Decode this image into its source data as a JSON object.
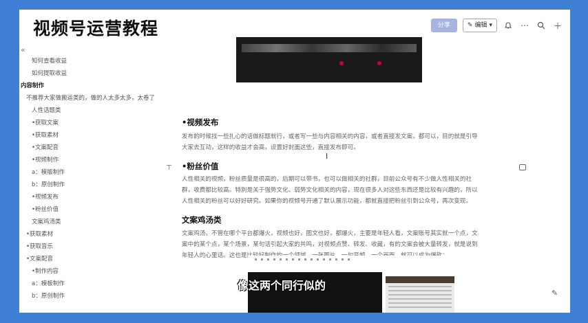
{
  "header": {
    "course_title": "视频号运营教程",
    "share_label": "分享",
    "edit_label": "编辑"
  },
  "sidebar": {
    "items": [
      {
        "label": "知何查看收益",
        "level": 2
      },
      {
        "label": "如何提取收益",
        "level": 2
      },
      {
        "label": "内容制作",
        "level": 0
      },
      {
        "label": "不推荐大家做搬运类的，做的人太多太多，太卷了",
        "level": 1
      },
      {
        "label": "人性话题类",
        "level": 2
      },
      {
        "label": "•获取文案",
        "level": 2
      },
      {
        "label": "•获取素材",
        "level": 2
      },
      {
        "label": "•文案配音",
        "level": 2
      },
      {
        "label": "•视频制作",
        "level": 2
      },
      {
        "label": "a：模版制作",
        "level": 2
      },
      {
        "label": "b：原创制作",
        "level": 2
      },
      {
        "label": "•视频发布",
        "level": 2
      },
      {
        "label": "•粉丝价值",
        "level": 2
      },
      {
        "label": "文案鸡汤类",
        "level": 2
      },
      {
        "label": "•获取素材",
        "level": 1
      },
      {
        "label": "•获取音乐",
        "level": 1
      },
      {
        "label": "•文案配音",
        "level": 1
      },
      {
        "label": "•制作内容",
        "level": 2
      },
      {
        "label": "a：模板制作",
        "level": 2
      },
      {
        "label": "b：原创制作",
        "level": 2
      }
    ]
  },
  "content": {
    "section1_title": "•视频发布",
    "section1_l1": "发布的时候找一些扎心的话做标题就行，或者写一些与内容相关的内容，或者直接发文案，都可以，目的就是引导",
    "section1_l2": "大家去互动，这样的收益才会高，设置好封面这些，直接发布即可。",
    "section2_title": "•粉丝价值",
    "section2_l1": "人性相关的视频，粉丝质量是很高的，后期可以带书，也可以做相关的社群，目前公众号有不少做人性相关的社",
    "section2_l2": "群，收费都比较高。特别是关于强势文化、弱势文化相关的内容，现在很多人对这些东西还是比较有兴趣的，所以",
    "section2_l3": "人性相关的粉丝可以好好研究。如果你的视频号开通了默认展示功能，都就直接把粉丝引到公众号，再次变现。",
    "section3_title": "文案鸡汤类",
    "section3_l1": "文案鸡汤，不管在哪个平台都爆火，视频也好，图文也好，都爆火，主要是年轻人看，文案账号其实就一个点，文",
    "section3_l2": "案中的某个点，某个场景，某句话引起大家的共鸣，对视频点赞、转发、收藏，有的文案会被大量转发，就是说到",
    "section3_l3": "年轻人的心里话。这也是比较好制作的一个领域，一张图片，一句音频，一个画面，就可以成为爆款："
  },
  "video_subtitle": "像这两个同行似的"
}
